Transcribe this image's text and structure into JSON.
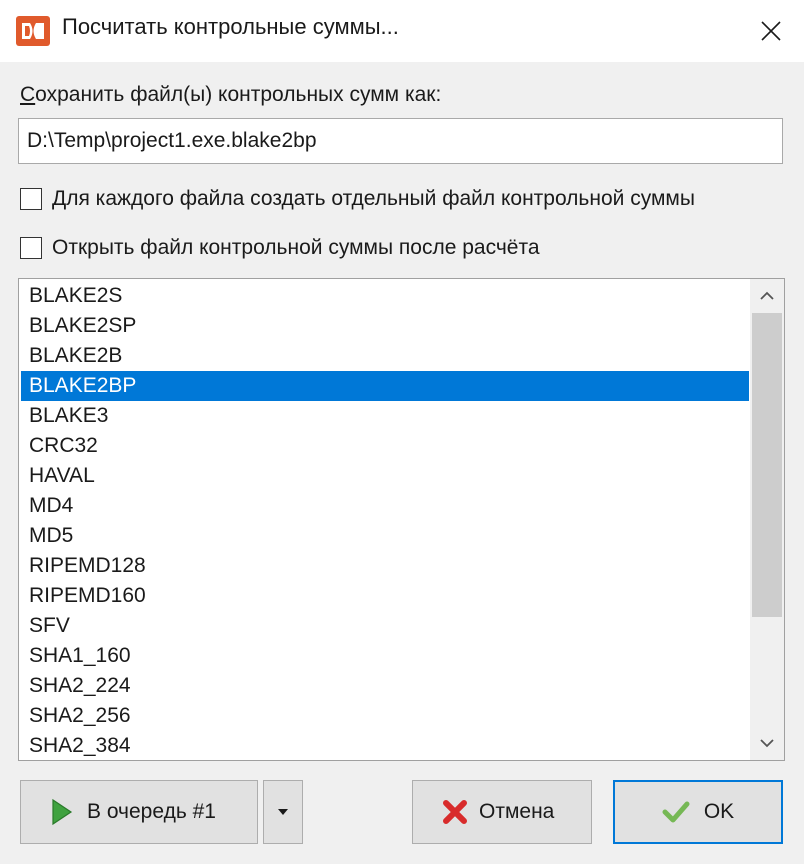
{
  "window": {
    "title": "Посчитать контрольные суммы...",
    "app_icon": "double-commander-logo-icon",
    "close_icon": "close-icon"
  },
  "save": {
    "label_mnemonic": "С",
    "label_rest": "охранить файл(ы) контрольных сумм как:",
    "path_value": "D:\\Temp\\project1.exe.blake2bp"
  },
  "options": [
    {
      "label": "Для каждого файла создать отдельный файл контрольной суммы",
      "checked": false
    },
    {
      "label": "Открыть файл контрольной суммы после расчёта",
      "checked": false
    }
  ],
  "algorithms": {
    "items": [
      "BLAKE2S",
      "BLAKE2SP",
      "BLAKE2B",
      "BLAKE2BP",
      "BLAKE3",
      "CRC32",
      "HAVAL",
      "MD4",
      "MD5",
      "RIPEMD128",
      "RIPEMD160",
      "SFV",
      "SHA1_160",
      "SHA2_224",
      "SHA2_256",
      "SHA2_384"
    ],
    "selected": "BLAKE2BP"
  },
  "buttons": {
    "queue_label": "В очередь #1",
    "cancel_label": "Отмена",
    "ok_label": "OK"
  },
  "colors": {
    "selection": "#0078d7",
    "queue_icon": "#3fa23f",
    "cancel_icon": "#d82b2b",
    "ok_icon": "#76b855"
  }
}
